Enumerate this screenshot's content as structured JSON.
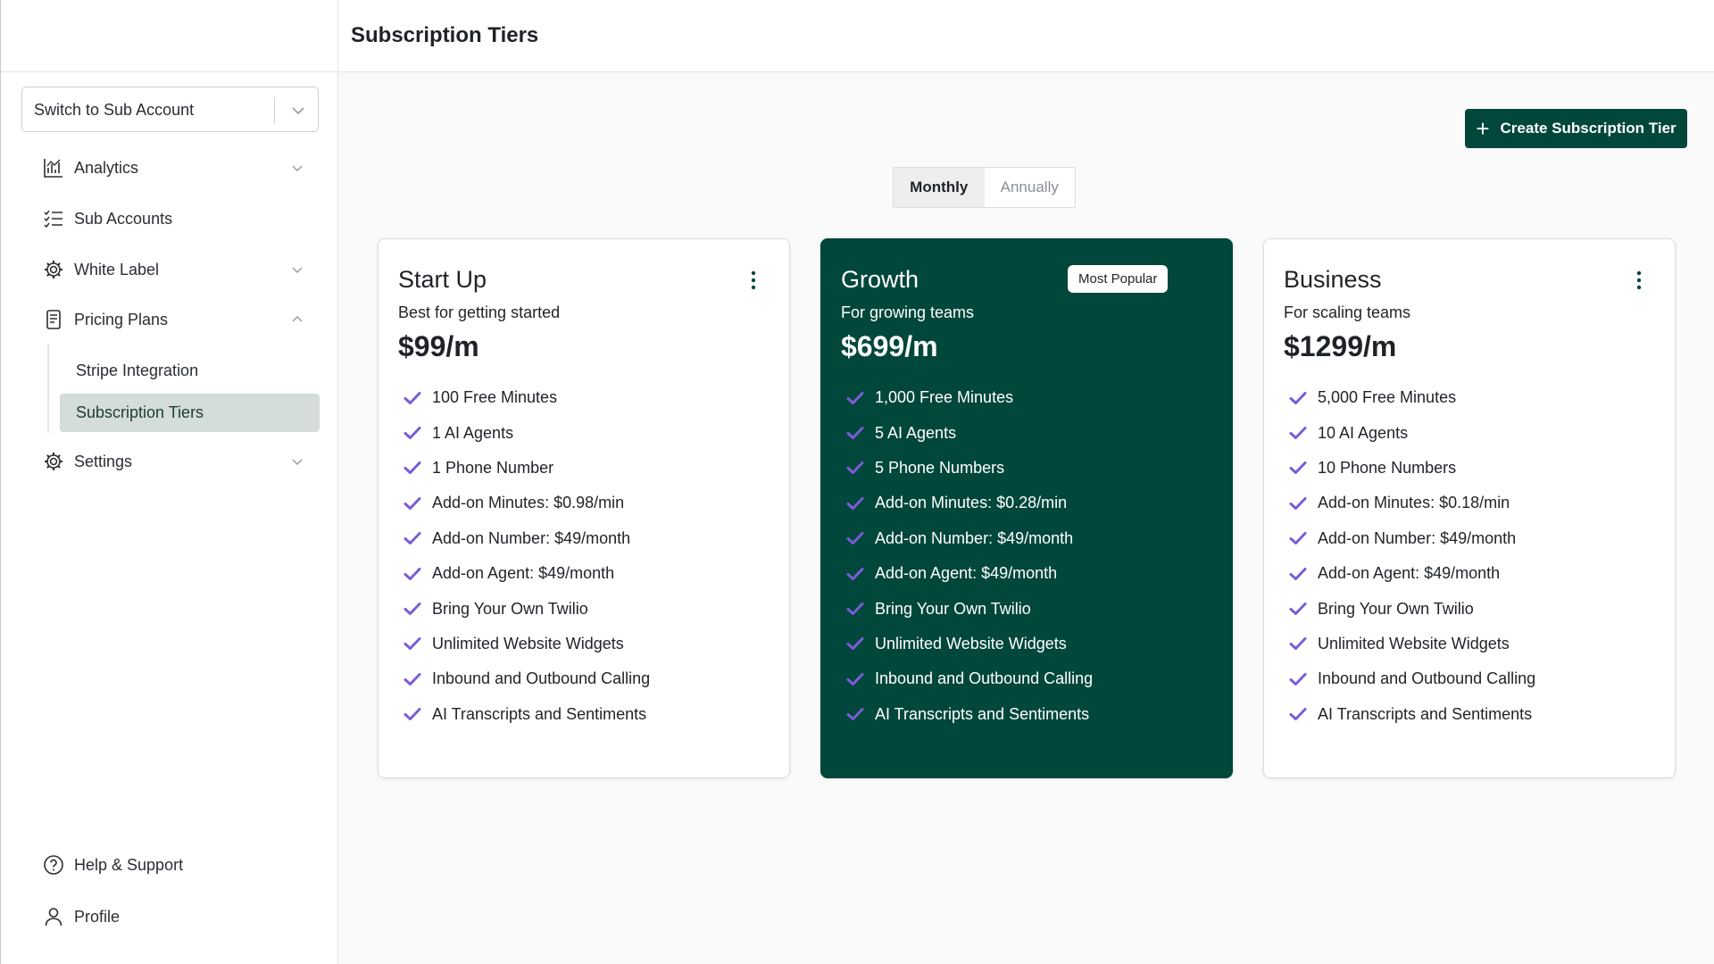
{
  "header": {
    "title": "Subscription Tiers"
  },
  "account_switcher": {
    "label": "Switch to Sub Account"
  },
  "sidebar": {
    "items": [
      {
        "label": "Analytics",
        "icon": "bar-chart-icon",
        "has_chevron": true,
        "expanded": false
      },
      {
        "label": "Sub Accounts",
        "icon": "checklist-icon",
        "has_chevron": false
      },
      {
        "label": "White Label",
        "icon": "gear-icon",
        "has_chevron": true,
        "expanded": false
      },
      {
        "label": "Pricing Plans",
        "icon": "document-icon",
        "has_chevron": true,
        "expanded": true
      },
      {
        "label": "Settings",
        "icon": "gear-icon",
        "has_chevron": true,
        "expanded": false
      }
    ],
    "pricing_subitems": [
      {
        "label": "Stripe Integration",
        "active": false
      },
      {
        "label": "Subscription Tiers",
        "active": true
      }
    ],
    "footer": [
      {
        "label": "Help & Support",
        "icon": "help-circle-icon"
      },
      {
        "label": "Profile",
        "icon": "user-icon"
      }
    ]
  },
  "actions": {
    "create_label": "Create Subscription Tier"
  },
  "billing_toggle": {
    "options": [
      "Monthly",
      "Annually"
    ],
    "selected": "Monthly"
  },
  "colors": {
    "brand": "#02473c",
    "check": "#7b5cd6",
    "active_subitem": "#d4ddd9"
  },
  "plans": [
    {
      "name": "Start Up",
      "description": "Best for getting started",
      "price": "$99/m",
      "featured": false,
      "features": [
        "100 Free Minutes",
        "1 AI Agents",
        "1 Phone Number",
        "Add-on Minutes: $0.98/min",
        "Add-on Number: $49/month",
        "Add-on Agent: $49/month",
        "Bring Your Own Twilio",
        "Unlimited Website Widgets",
        "Inbound and Outbound Calling",
        "AI Transcripts and Sentiments"
      ]
    },
    {
      "name": "Growth",
      "description": "For growing teams",
      "price": "$699/m",
      "featured": true,
      "badge": "Most Popular",
      "features": [
        "1,000 Free Minutes",
        "5 AI Agents",
        "5 Phone Numbers",
        "Add-on Minutes: $0.28/min",
        "Add-on Number: $49/month",
        "Add-on Agent: $49/month",
        "Bring Your Own Twilio",
        "Unlimited Website Widgets",
        "Inbound and Outbound Calling",
        "AI Transcripts and Sentiments"
      ]
    },
    {
      "name": "Business",
      "description": "For scaling teams",
      "price": "$1299/m",
      "featured": false,
      "features": [
        "5,000 Free Minutes",
        "10 AI Agents",
        "10 Phone Numbers",
        "Add-on Minutes: $0.18/min",
        "Add-on Number: $49/month",
        "Add-on Agent: $49/month",
        "Bring Your Own Twilio",
        "Unlimited Website Widgets",
        "Inbound and Outbound Calling",
        "AI Transcripts and Sentiments"
      ]
    }
  ]
}
